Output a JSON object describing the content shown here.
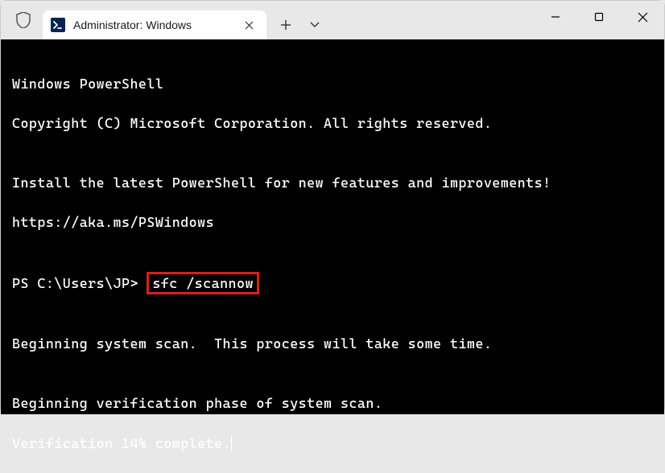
{
  "titlebar": {
    "tab_title": "Administrator: Windows",
    "tab_close": "✕",
    "new_tab": "+",
    "dropdown": "⌄"
  },
  "terminal": {
    "line1": "Windows PowerShell",
    "line2": "Copyright (C) Microsoft Corporation. All rights reserved.",
    "line3": "",
    "line4": "Install the latest PowerShell for new features and improvements!",
    "line5": "https://aka.ms/PSWindows",
    "line6": "",
    "prompt": "PS C:\\Users\\JP> ",
    "command": "sfc /scannow",
    "line8": "",
    "line9": "Beginning system scan.  This process will take some time.",
    "line10": "",
    "line11": "Beginning verification phase of system scan.",
    "line12": "Verification 14% complete."
  }
}
